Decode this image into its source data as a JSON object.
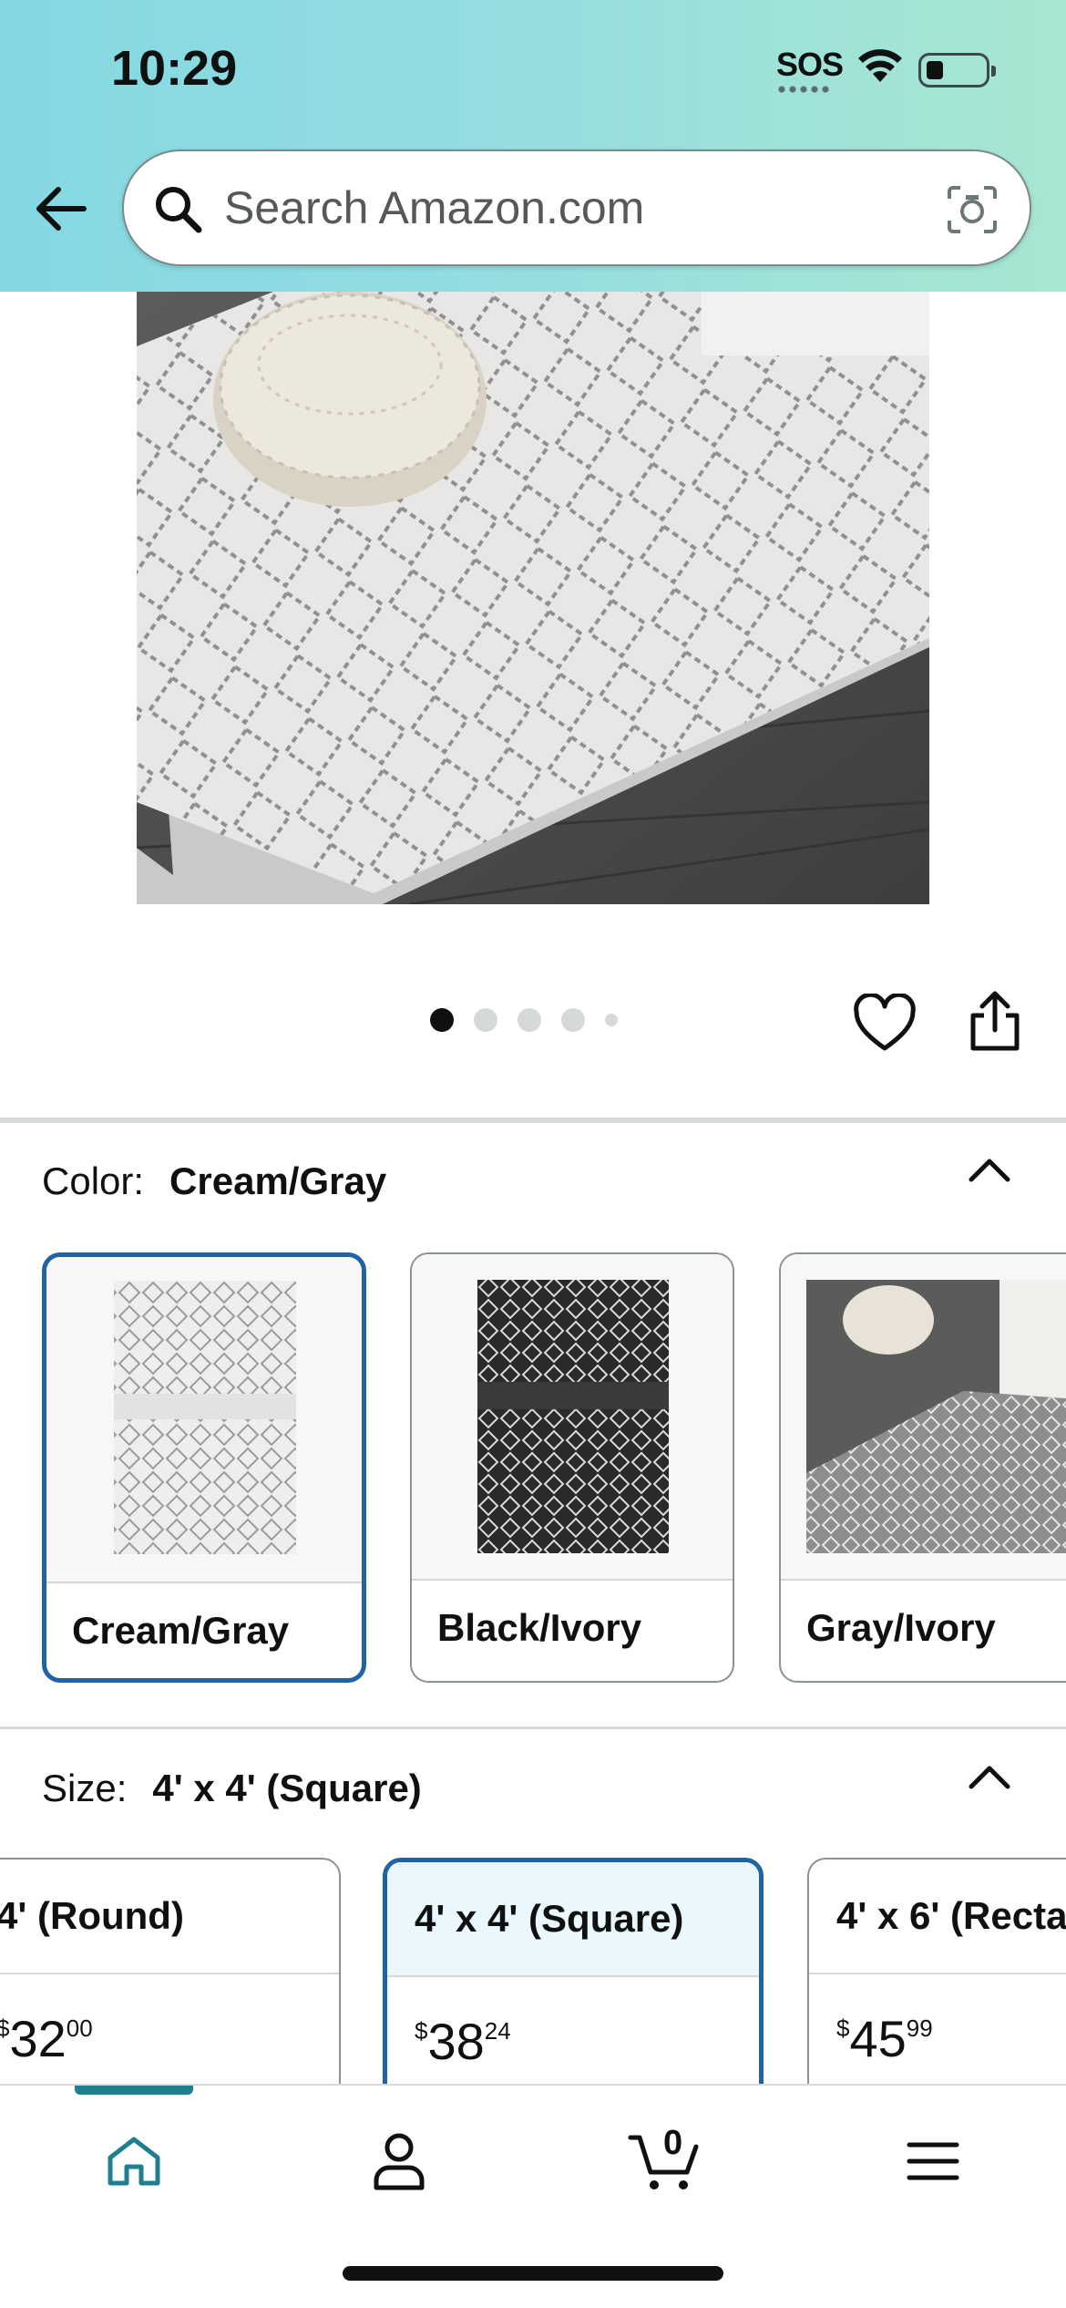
{
  "status_bar": {
    "time": "10:29",
    "sos": "SOS",
    "battery_level": 0.2
  },
  "search": {
    "placeholder": "Search Amazon.com",
    "value": ""
  },
  "gallery": {
    "image_count": 5,
    "active_index": 0
  },
  "color": {
    "label": "Color:",
    "selected": "Cream/Gray",
    "options": [
      {
        "name": "Cream/Gray",
        "selected": true
      },
      {
        "name": "Black/Ivory",
        "selected": false
      },
      {
        "name": "Gray/Ivory",
        "selected": false
      }
    ]
  },
  "size": {
    "label": "Size:",
    "selected": "4' x 4' (Square)",
    "options": [
      {
        "name": "4' (Round)",
        "price_symbol": "$",
        "price_whole": "32",
        "price_fraction": "00",
        "selected": false
      },
      {
        "name": "4' x 4' (Square)",
        "price_symbol": "$",
        "price_whole": "38",
        "price_fraction": "24",
        "selected": true
      },
      {
        "name": "4' x 6' (Recta",
        "price_symbol": "$",
        "price_whole": "45",
        "price_fraction": "99",
        "selected": false
      }
    ]
  },
  "bottom_nav": {
    "items": [
      "home-icon",
      "account-icon",
      "cart-icon",
      "menu-icon"
    ],
    "active": "home-icon",
    "cart_count": "0"
  },
  "colors": {
    "accent_teal": "#1f7f8f",
    "selection_blue": "#2162a1",
    "selected_size_bg": "#eaf7fc"
  }
}
